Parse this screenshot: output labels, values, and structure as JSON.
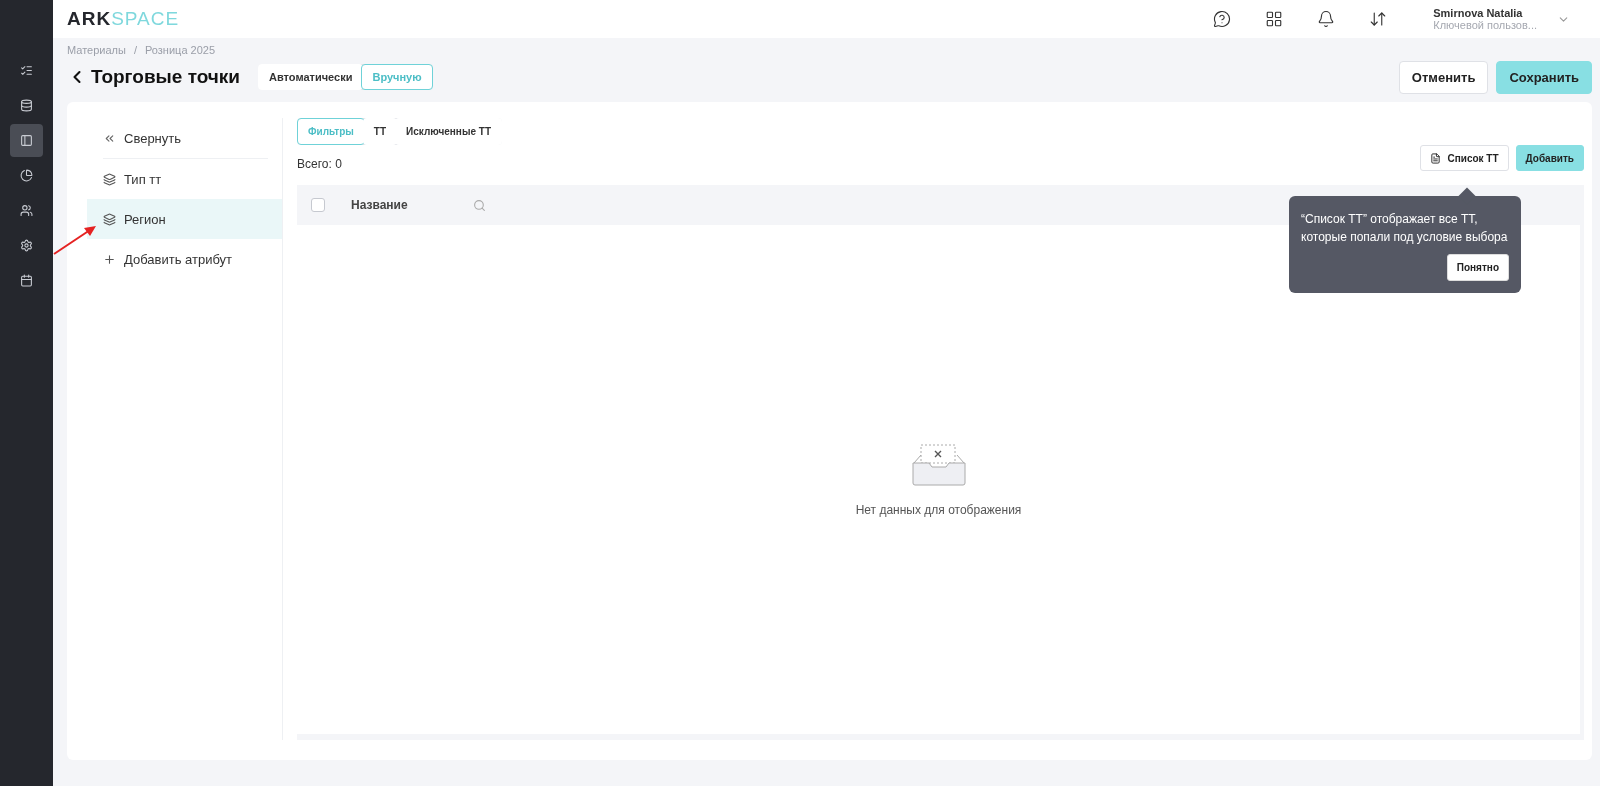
{
  "brand": {
    "dark": "ARK",
    "light": "SPACE"
  },
  "nav_rail": [
    {
      "kind": "list",
      "selected": false
    },
    {
      "kind": "database",
      "selected": false
    },
    {
      "kind": "panel",
      "selected": true
    },
    {
      "kind": "chart",
      "selected": false
    },
    {
      "kind": "users",
      "selected": false
    },
    {
      "kind": "settings",
      "selected": false
    },
    {
      "kind": "calendar",
      "selected": false
    }
  ],
  "header_icons": [
    {
      "kind": "help"
    },
    {
      "kind": "apps"
    },
    {
      "kind": "bell"
    },
    {
      "kind": "exchange"
    }
  ],
  "user": {
    "name": "Smirnova Natalia",
    "role": "Ключевой пользов..."
  },
  "breadcrumbs": [
    "Материалы",
    "Розница 2025"
  ],
  "breadcrumb_separator": "/",
  "title": "Торговые точки",
  "mode_toggle": [
    {
      "label": "Автоматически",
      "selected": false
    },
    {
      "label": "Вручную",
      "selected": true
    }
  ],
  "actions": [
    {
      "label": "Отменить",
      "kind": "secondary"
    },
    {
      "label": "Сохранить",
      "kind": "primary"
    }
  ],
  "side_panel": {
    "collapse": "Свернуть",
    "items": [
      {
        "label": "Тип тт",
        "kind": "layers",
        "selected": false
      },
      {
        "label": "Регион",
        "kind": "layers",
        "selected": true
      },
      {
        "label": "Добавить атрибут",
        "kind": "add",
        "selected": false
      }
    ]
  },
  "tabs": [
    {
      "label": "Фильтры",
      "selected": true
    },
    {
      "label": "ТТ",
      "selected": false
    },
    {
      "label": "Исключенные ТТ",
      "selected": false
    }
  ],
  "total": "Всего: 0",
  "toolbar": [
    {
      "label": "Список ТТ",
      "kind": "secondary"
    },
    {
      "label": "Добавить",
      "kind": "primary"
    }
  ],
  "table": {
    "columns": [
      "Название"
    ],
    "select_all_checked": false,
    "empty_text": "Нет данных для отображения"
  },
  "tooltip": {
    "text": "“Список ТТ” отображает все ТТ, которые попали под условие выбора",
    "button": "Понятно"
  }
}
